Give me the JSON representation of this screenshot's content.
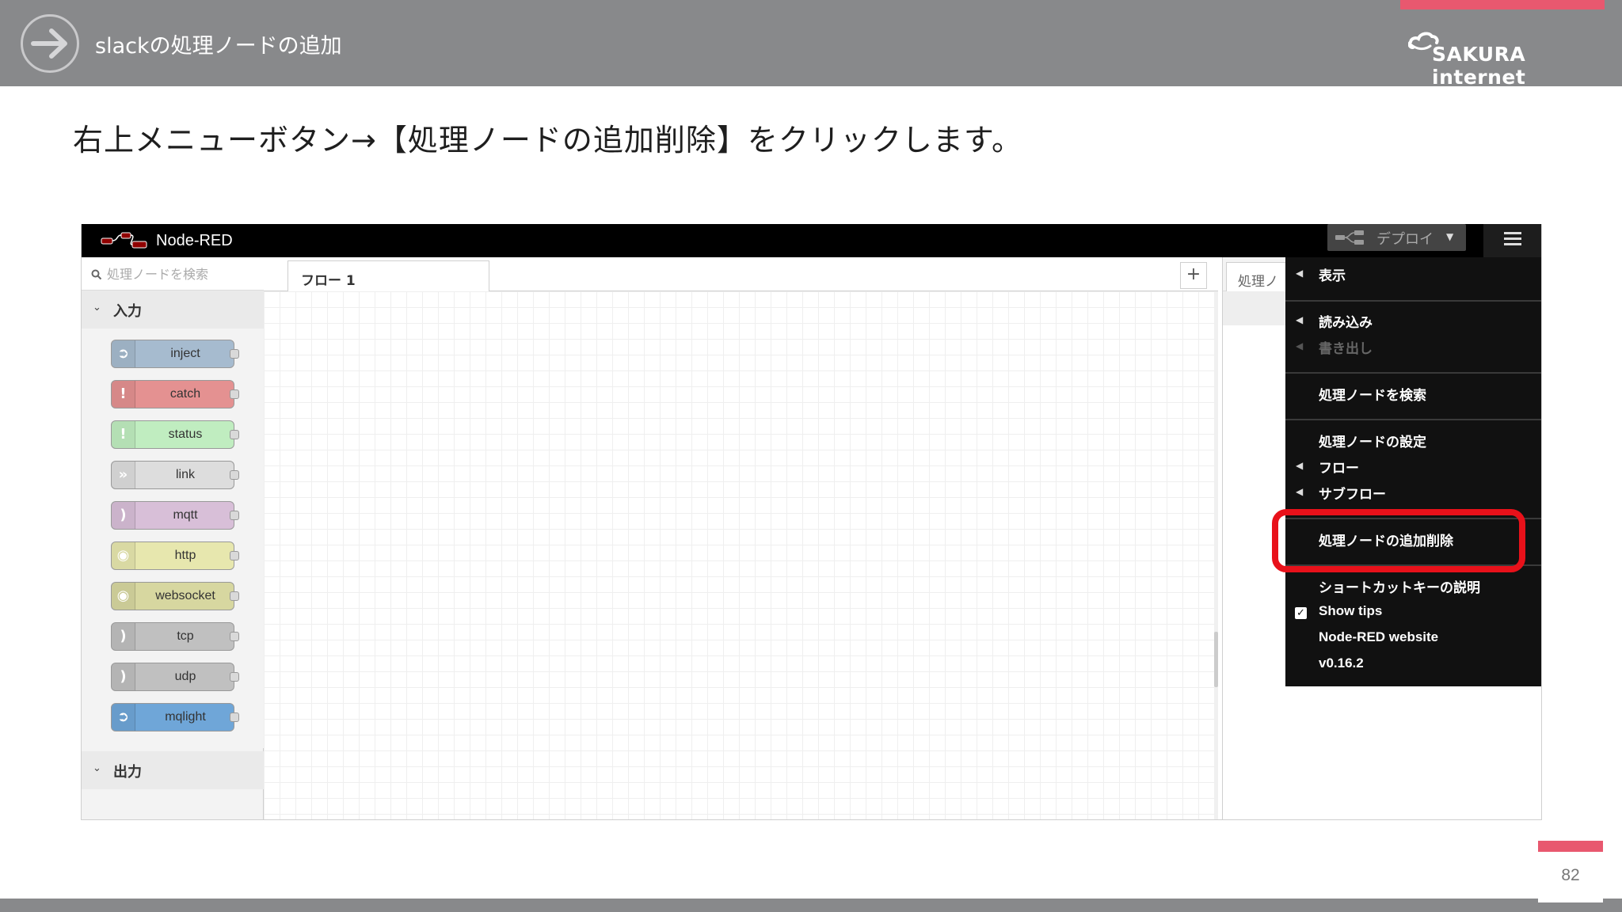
{
  "slide": {
    "title": "slackの処理ノードの追加",
    "instruction": "右上メニューボタン→【処理ノードの追加削除】をクリックします。",
    "brand": "SAKURA internet",
    "page_number": "82",
    "accent_color": "#e8586f",
    "header_color": "#88898b"
  },
  "nodered": {
    "app_title": "Node-RED",
    "deploy_label": "デプロイ",
    "palette": {
      "search_placeholder": "処理ノードを検索",
      "category_input": "入力",
      "category_output": "出力",
      "nodes": [
        {
          "label": "inject",
          "color": "#a6bbcf"
        },
        {
          "label": "catch",
          "color": "#e49191"
        },
        {
          "label": "status",
          "color": "#c0edc0"
        },
        {
          "label": "link",
          "color": "#dddddd"
        },
        {
          "label": "mqtt",
          "color": "#d8bfd8"
        },
        {
          "label": "http",
          "color": "#e7e7ae"
        },
        {
          "label": "websocket",
          "color": "#d7d7a0"
        },
        {
          "label": "tcp",
          "color": "#c0c0c0"
        },
        {
          "label": "udp",
          "color": "#c0c0c0"
        },
        {
          "label": "mqlight",
          "color": "#6fa6d8"
        }
      ]
    },
    "workspace": {
      "tab_label": "フロー 1"
    },
    "sidebar": {
      "tab_label": "処理ノ"
    },
    "menu": {
      "view": "表示",
      "import": "読み込み",
      "export": "書き出し",
      "search": "処理ノードを検索",
      "config_nodes": "処理ノードの設定",
      "flows": "フロー",
      "subflows": "サブフロー",
      "manage_palette": "処理ノードの追加削除",
      "keyboard_shortcuts": "ショートカットキーの説明",
      "show_tips": "Show tips",
      "website": "Node-RED website",
      "version": "v0.16.2"
    }
  }
}
